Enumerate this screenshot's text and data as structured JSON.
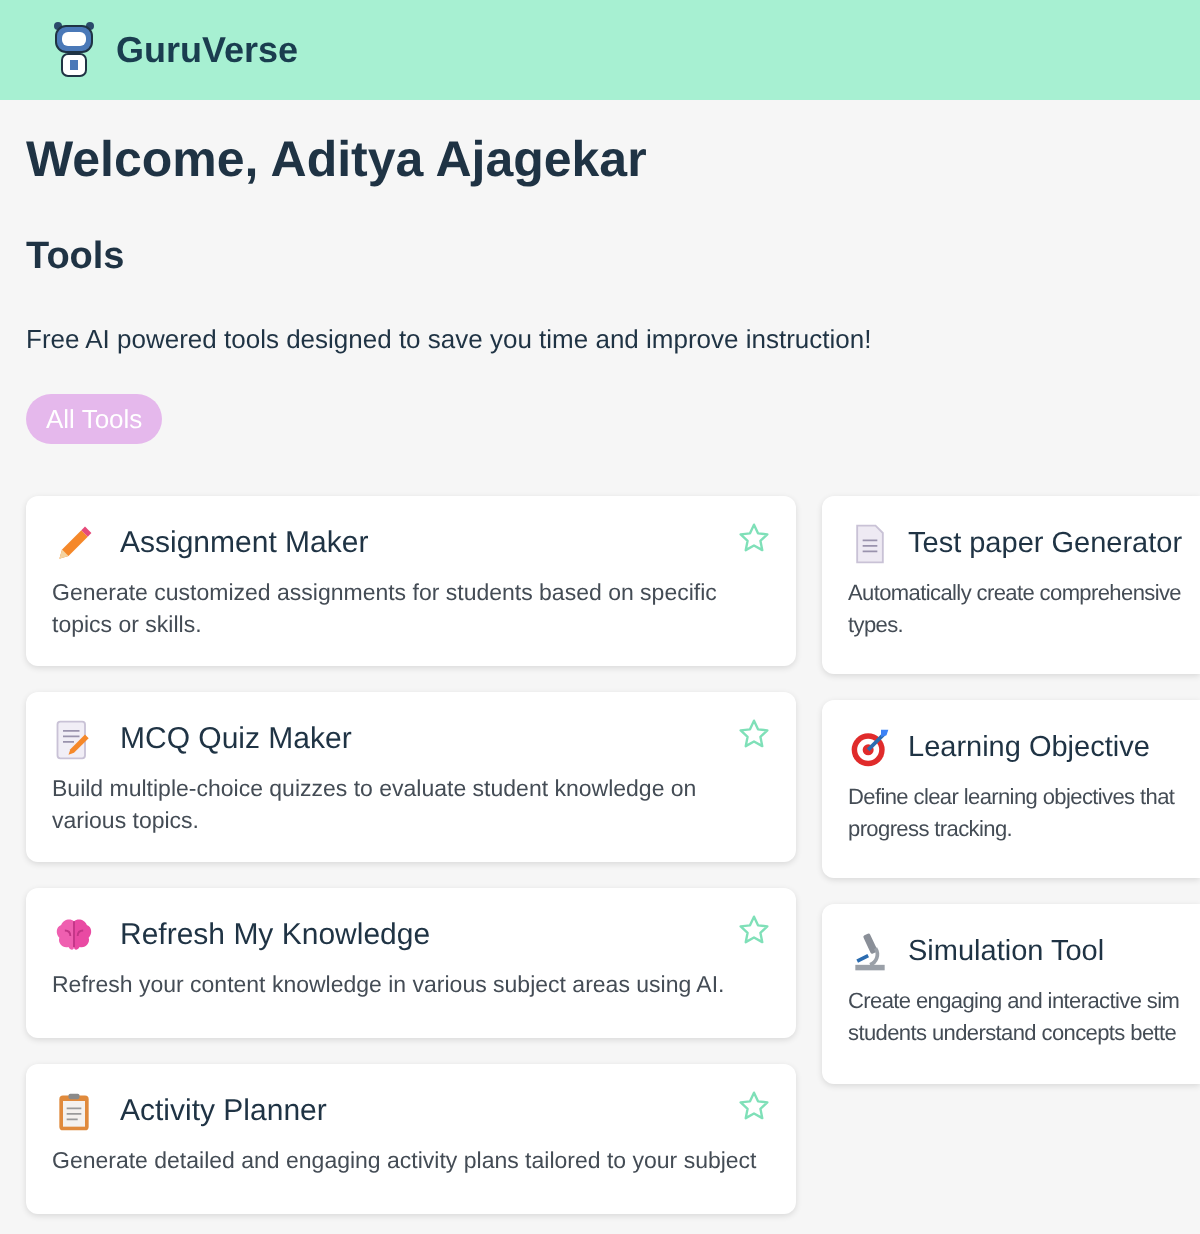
{
  "brand": {
    "name": "GuruVerse"
  },
  "welcome": "Welcome, Aditya Ajagekar",
  "section_title": "Tools",
  "subtitle": "Free AI powered tools designed to save you time and improve instruction!",
  "filters": [
    {
      "label": "All Tools",
      "selected": true
    }
  ],
  "tools_left": [
    {
      "kind": "pencil",
      "title": "Assignment Maker",
      "description": "Generate customized assignments for students based on specific topics or skills.",
      "favorite": false
    },
    {
      "kind": "memo",
      "title": "MCQ Quiz Maker",
      "description": "Build multiple-choice quizzes to evaluate student knowledge on various topics.",
      "favorite": false
    },
    {
      "kind": "brain",
      "title": "Refresh My Knowledge",
      "description": "Refresh your content knowledge in various subject areas using AI.",
      "favorite": false
    },
    {
      "kind": "clipboard",
      "title": "Activity Planner",
      "description": "Generate detailed and engaging activity plans tailored to your subject",
      "favorite": false
    }
  ],
  "tools_right": [
    {
      "kind": "document",
      "title": "Test paper Generator",
      "lines": [
        "Automatically create comprehensive",
        "types."
      ]
    },
    {
      "kind": "target",
      "title": "Learning Objective",
      "lines": [
        "Define clear learning objectives that",
        "progress tracking."
      ]
    },
    {
      "kind": "microscope",
      "title": "Simulation Tool",
      "lines": [
        "Create engaging and interactive sim",
        "students understand concepts bette"
      ]
    }
  ]
}
